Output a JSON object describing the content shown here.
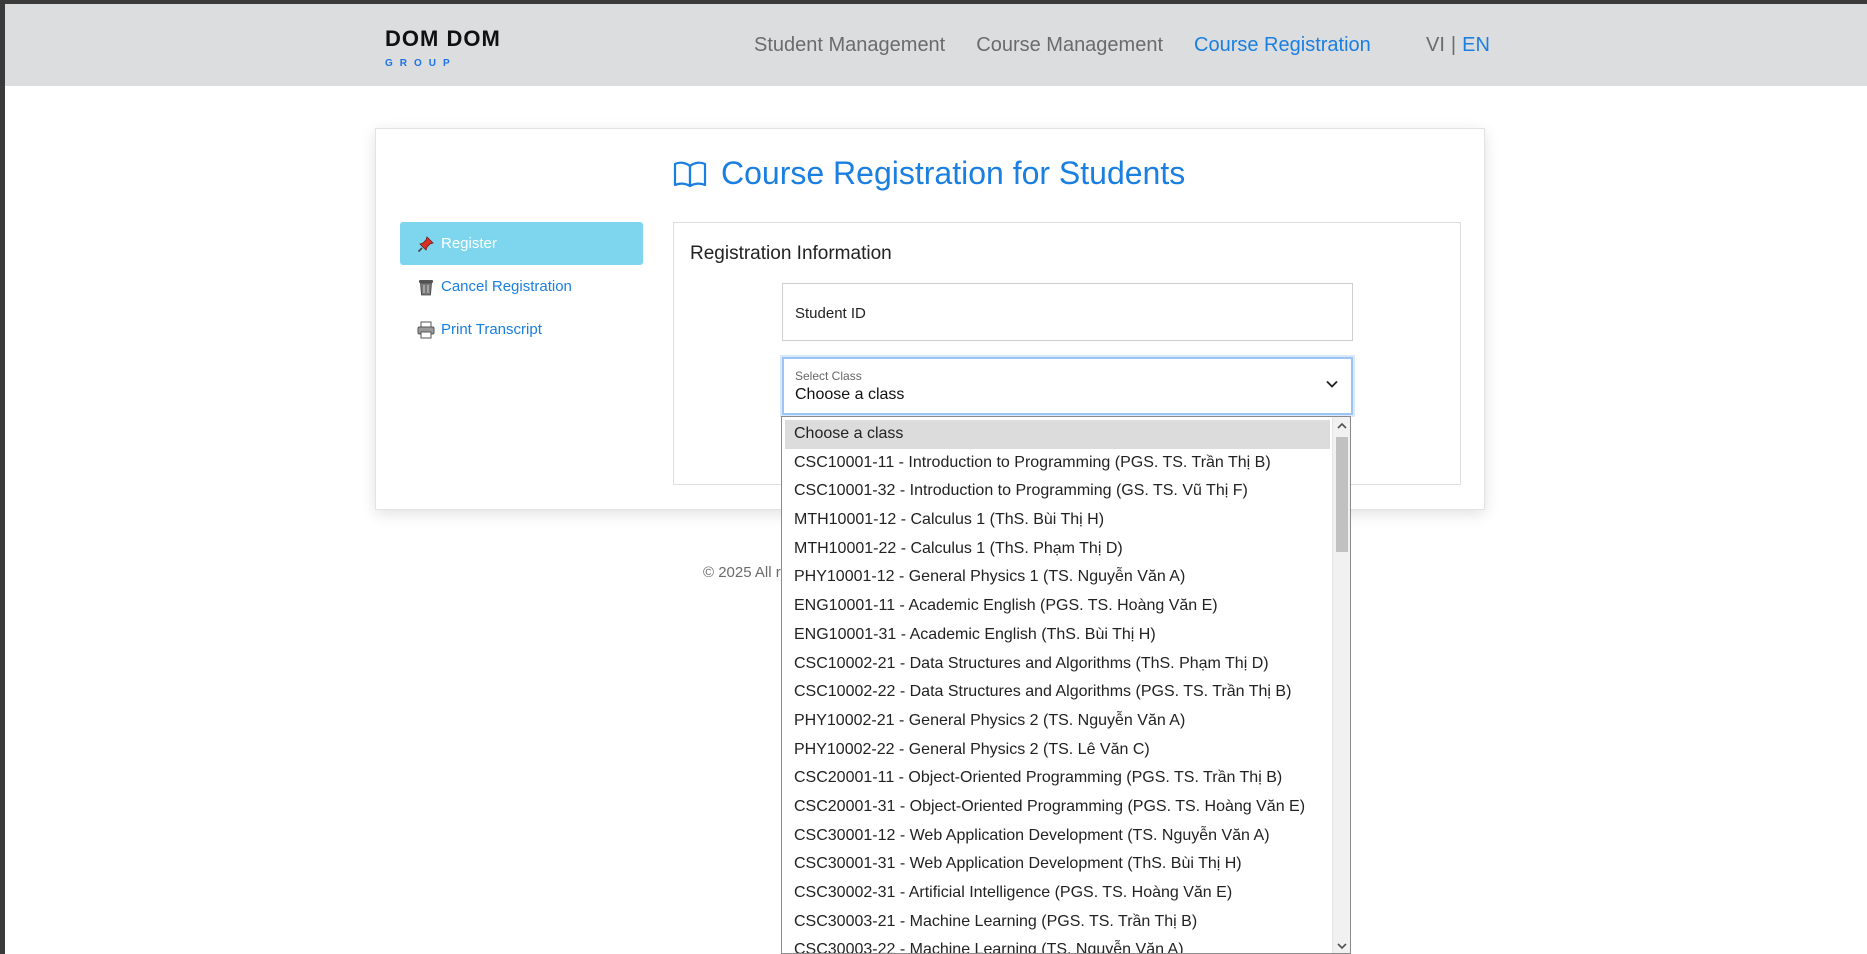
{
  "header": {
    "logo_main": "DOM DOM",
    "logo_sub": "GROUP",
    "nav": [
      {
        "label": "Student Management"
      },
      {
        "label": "Course Management"
      },
      {
        "label": "Course Registration",
        "active": true
      }
    ],
    "lang_vi": "VI",
    "lang_sep": "|",
    "lang_en": "EN"
  },
  "page": {
    "title": "Course Registration for Students"
  },
  "sidebar": {
    "items": [
      {
        "label": "Register",
        "icon": "pushpin-icon",
        "active": true
      },
      {
        "label": "Cancel Registration",
        "icon": "trash-icon"
      },
      {
        "label": "Print Transcript",
        "icon": "printer-icon"
      }
    ]
  },
  "form": {
    "section_title": "Registration Information",
    "student_id_label": "Student ID",
    "select_label": "Select Class",
    "select_value": "Choose a class"
  },
  "footer": {
    "text": "© 2025 All r"
  },
  "dropdown": {
    "options": [
      "Choose a class",
      "CSC10001-11 - Introduction to Programming (PGS. TS. Trần Thị B)",
      "CSC10001-32 - Introduction to Programming (GS. TS. Vũ Thị F)",
      "MTH10001-12 - Calculus 1 (ThS. Bùi Thị H)",
      "MTH10001-22 - Calculus 1 (ThS. Phạm Thị D)",
      "PHY10001-12 - General Physics 1 (TS. Nguyễn Văn A)",
      "ENG10001-11 - Academic English (PGS. TS. Hoàng Văn E)",
      "ENG10001-31 - Academic English (ThS. Bùi Thị H)",
      "CSC10002-21 - Data Structures and Algorithms (ThS. Phạm Thị D)",
      "CSC10002-22 - Data Structures and Algorithms (PGS. TS. Trần Thị B)",
      "PHY10002-21 - General Physics 2 (TS. Nguyễn Văn A)",
      "PHY10002-22 - General Physics 2 (TS. Lê Văn C)",
      "CSC20001-11 - Object-Oriented Programming (PGS. TS. Trần Thị B)",
      "CSC20001-31 - Object-Oriented Programming (PGS. TS. Hoàng Văn E)",
      "CSC30001-12 - Web Application Development (TS. Nguyễn Văn A)",
      "CSC30001-31 - Web Application Development (ThS. Bùi Thị H)",
      "CSC30002-31 - Artificial Intelligence (PGS. TS. Hoàng Văn E)",
      "CSC30003-21 - Machine Learning (PGS. TS. Trần Thị B)",
      "CSC30003-22 - Machine Learning (TS. Nguyễn Văn A)"
    ]
  },
  "colors": {
    "accent": "#1a7fe0",
    "header_bg": "#dcdddf",
    "active_menu_bg": "#7dd6ee"
  }
}
